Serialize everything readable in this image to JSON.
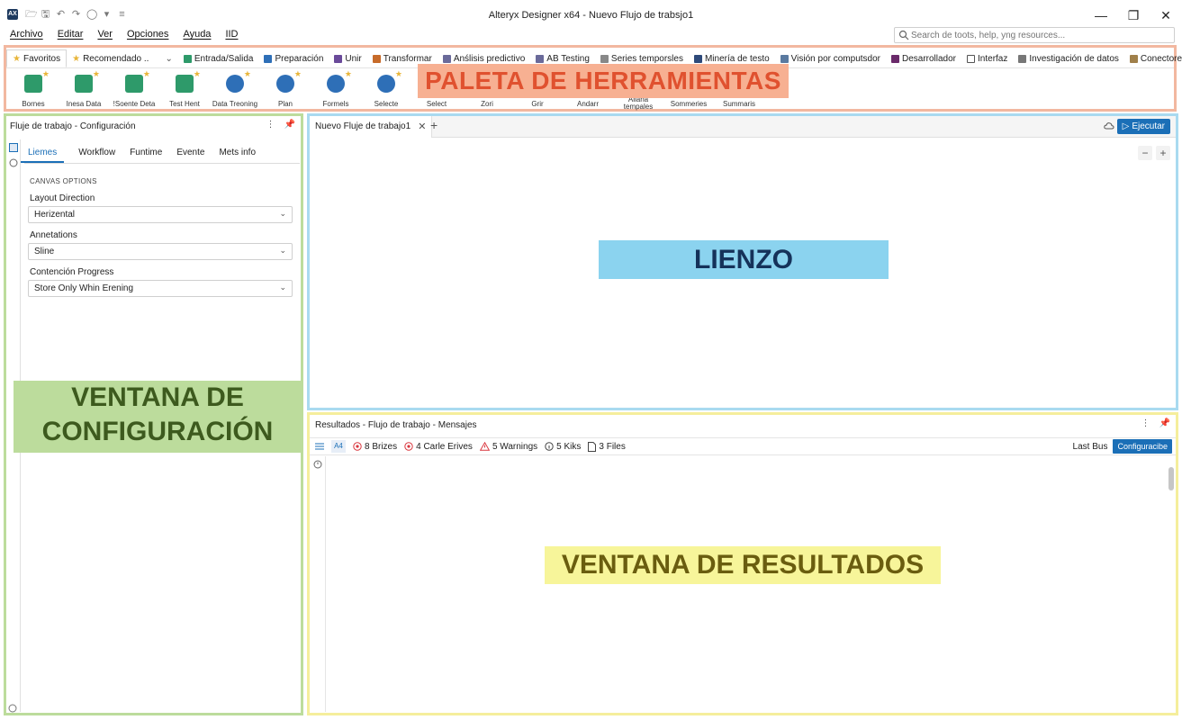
{
  "window": {
    "title": "Alteryx Designer x64 - Nuevo Flujo de trabsjo1",
    "logo_text": "AX"
  },
  "menu": [
    "Archivo",
    "Editar",
    "Ver",
    "Opciones",
    "Ayuda",
    "IID"
  ],
  "search": {
    "placeholder": "Search de toots, help, yng resources..."
  },
  "palette": {
    "tabs": [
      {
        "label": "Favoritos",
        "color": "#e8b53a"
      },
      {
        "label": "Recomendado ..",
        "color": "#e8b53a"
      },
      {
        "label": "Entrada/Salida",
        "color": "#2e9a6a"
      },
      {
        "label": "Preparación",
        "color": "#2e6fb7"
      },
      {
        "label": "Unir",
        "color": "#6a4a9a"
      },
      {
        "label": "Transformar",
        "color": "#c76b2a"
      },
      {
        "label": "Anślisis predictivo",
        "color": "#6a6a9a"
      },
      {
        "label": "AB Testing",
        "color": "#6a6a9a"
      },
      {
        "label": "Series temporsles",
        "color": "#888888"
      },
      {
        "label": "Minería de testo",
        "color": "#2e4a7a"
      },
      {
        "label": "Visión por computsdor",
        "color": "#5a7aa0"
      },
      {
        "label": "Desarrollador",
        "color": "#6a2a6a"
      },
      {
        "label": "Interfaz",
        "color": "#555555"
      },
      {
        "label": "Investigación de datos",
        "color": "#777777"
      },
      {
        "label": "Conectores",
        "color": "#a0804a"
      }
    ],
    "tools": [
      {
        "label": "Bornes",
        "color": "#2e9a6a"
      },
      {
        "label": "Inesa Data",
        "color": "#2e9a6a"
      },
      {
        "label": "!Soente Deta",
        "color": "#2e9a6a"
      },
      {
        "label": "Test Hent",
        "color": "#2e9a6a"
      },
      {
        "label": "Data Treoning",
        "color": "#2e6fb7"
      },
      {
        "label": "Plan",
        "color": "#2e6fb7"
      },
      {
        "label": "Formels",
        "color": "#2e6fb7"
      },
      {
        "label": "Selecte",
        "color": "#2e6fb7"
      },
      {
        "label": "Select",
        "color": "#ffffff"
      },
      {
        "label": "Zori",
        "color": "#ffffff"
      },
      {
        "label": "Grir",
        "color": "#ffffff"
      },
      {
        "label": "Andarr",
        "color": "#ffffff"
      },
      {
        "label": "Aliana tempales",
        "color": "#ffffff"
      },
      {
        "label": "Sommeries",
        "color": "#ffffff"
      },
      {
        "label": "Summaris",
        "color": "#ffffff"
      }
    ],
    "overlay_label": "PALETA DE HERRAMIENTAS"
  },
  "config": {
    "title": "Fluje de trabajo - Configuración",
    "tabs": [
      "Liemes",
      "Workflow",
      "Funtime",
      "Evente",
      "Mets info"
    ],
    "section": "CANVAS OPTIONS",
    "fields": [
      {
        "label": "Layout Direction",
        "value": "Herizental"
      },
      {
        "label": "Annetations",
        "value": "Sline"
      },
      {
        "label": "Contención Progress",
        "value": "Store Only Whin Erening"
      }
    ],
    "overlay_label": "VENTANA DE CONFIGURACIÓN"
  },
  "canvas": {
    "tab_label": "Nuevo Fluje de trabajo1",
    "run_label": "Ejecutar",
    "overlay_label": "LIENZO"
  },
  "results": {
    "title": "Resultados - Flujo de trabajo - Mensajes",
    "aa_label": "A4",
    "filters": [
      {
        "label": "8 Brizes",
        "icon": "error-icon",
        "color": "#d9363e"
      },
      {
        "label": "4 Carle Erives",
        "icon": "conversion-error-icon",
        "color": "#d9363e"
      },
      {
        "label": "5 Warnings",
        "icon": "warning-icon",
        "color": "#d9363e"
      },
      {
        "label": "5 Kiks",
        "icon": "info-icon",
        "color": "#444444"
      },
      {
        "label": "3 Files",
        "icon": "file-icon",
        "color": "#444444"
      }
    ],
    "last_bus": "Last Bus",
    "config_button": "Configuracibe",
    "overlay_label": "VENTANA DE RESULTADOS"
  }
}
